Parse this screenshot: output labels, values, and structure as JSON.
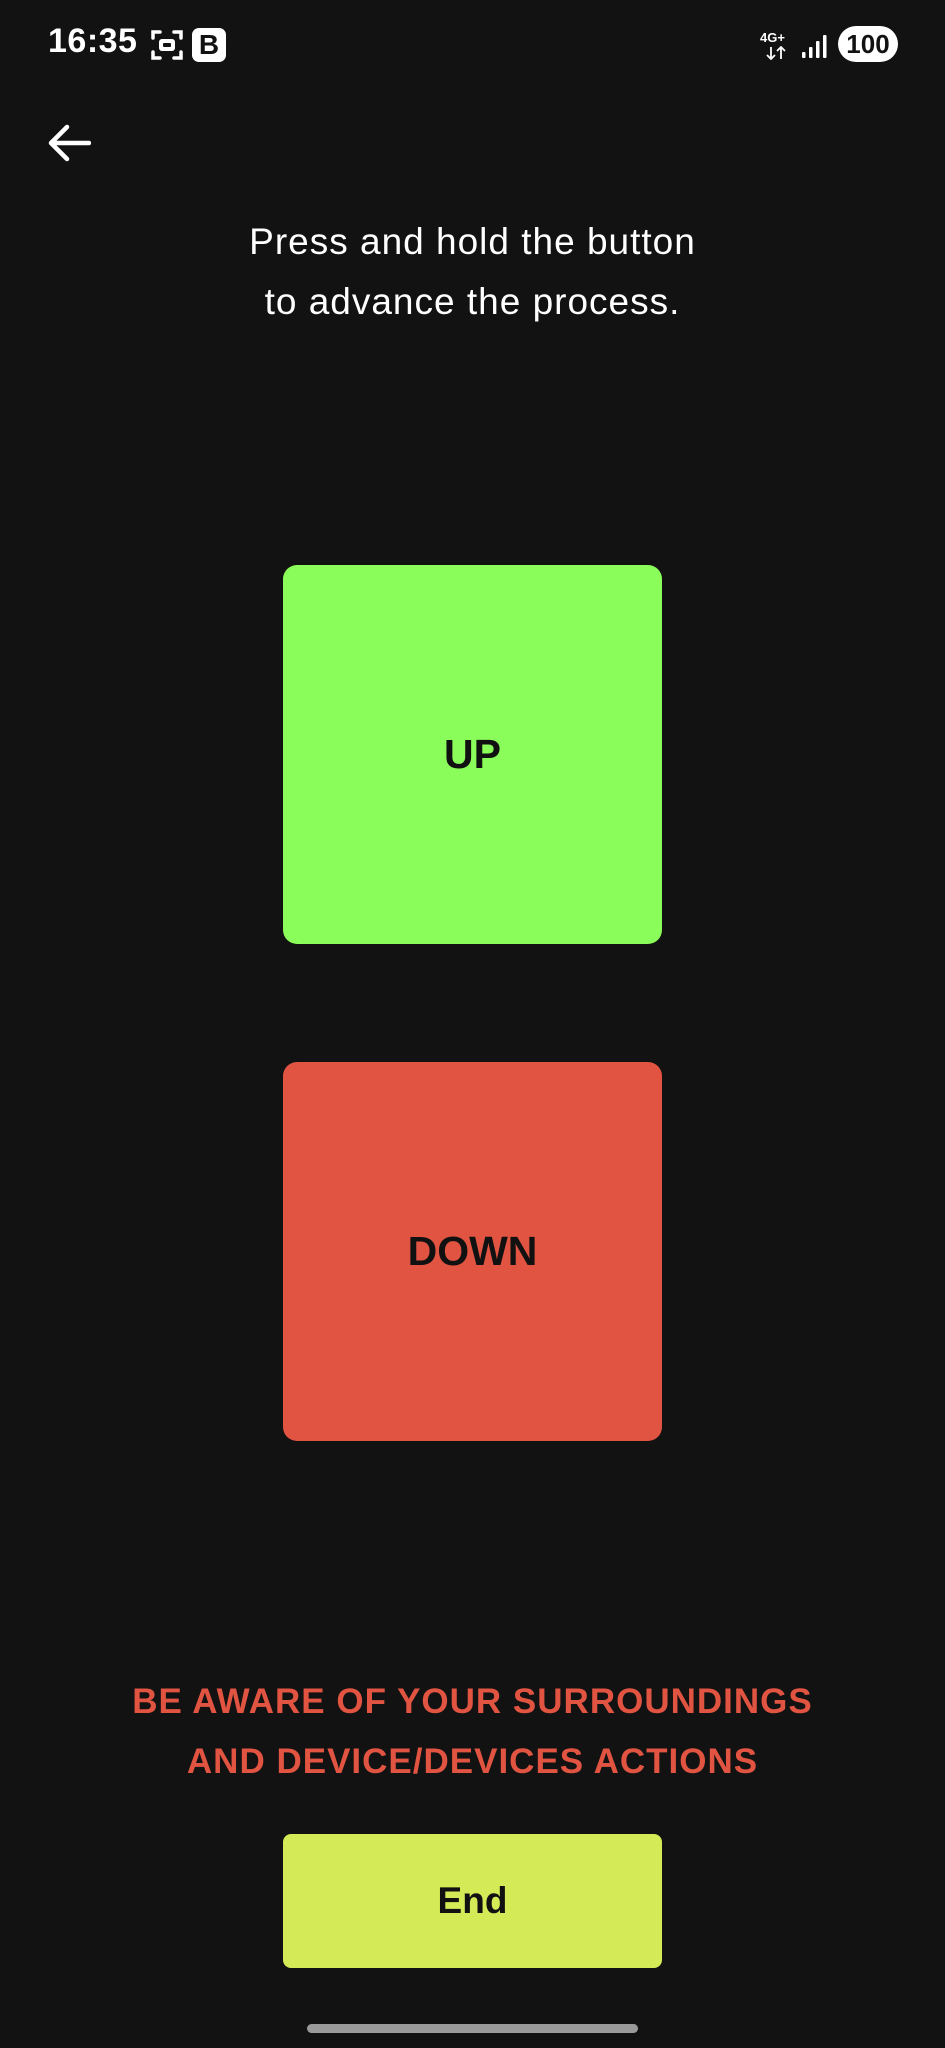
{
  "status_bar": {
    "time": "16:35",
    "badge": "B",
    "network_type": "4G+",
    "battery": "100",
    "icons": [
      "screenshot-icon",
      "signal-icon"
    ]
  },
  "header": {
    "back_icon": "arrow-left-icon"
  },
  "instruction": {
    "line1": "Press and hold the button",
    "line2": "to advance the process."
  },
  "controls": {
    "up_label": "UP",
    "down_label": "DOWN",
    "up_color": "#8afd5a",
    "down_color": "#e15441"
  },
  "warning": {
    "line1": "BE AWARE OF YOUR SURROUNDINGS",
    "line2": "AND DEVICE/DEVICES ACTIONS",
    "color": "#e15441"
  },
  "end_button": {
    "label": "End",
    "color": "#d4ea56"
  },
  "theme": {
    "background": "#121212"
  }
}
